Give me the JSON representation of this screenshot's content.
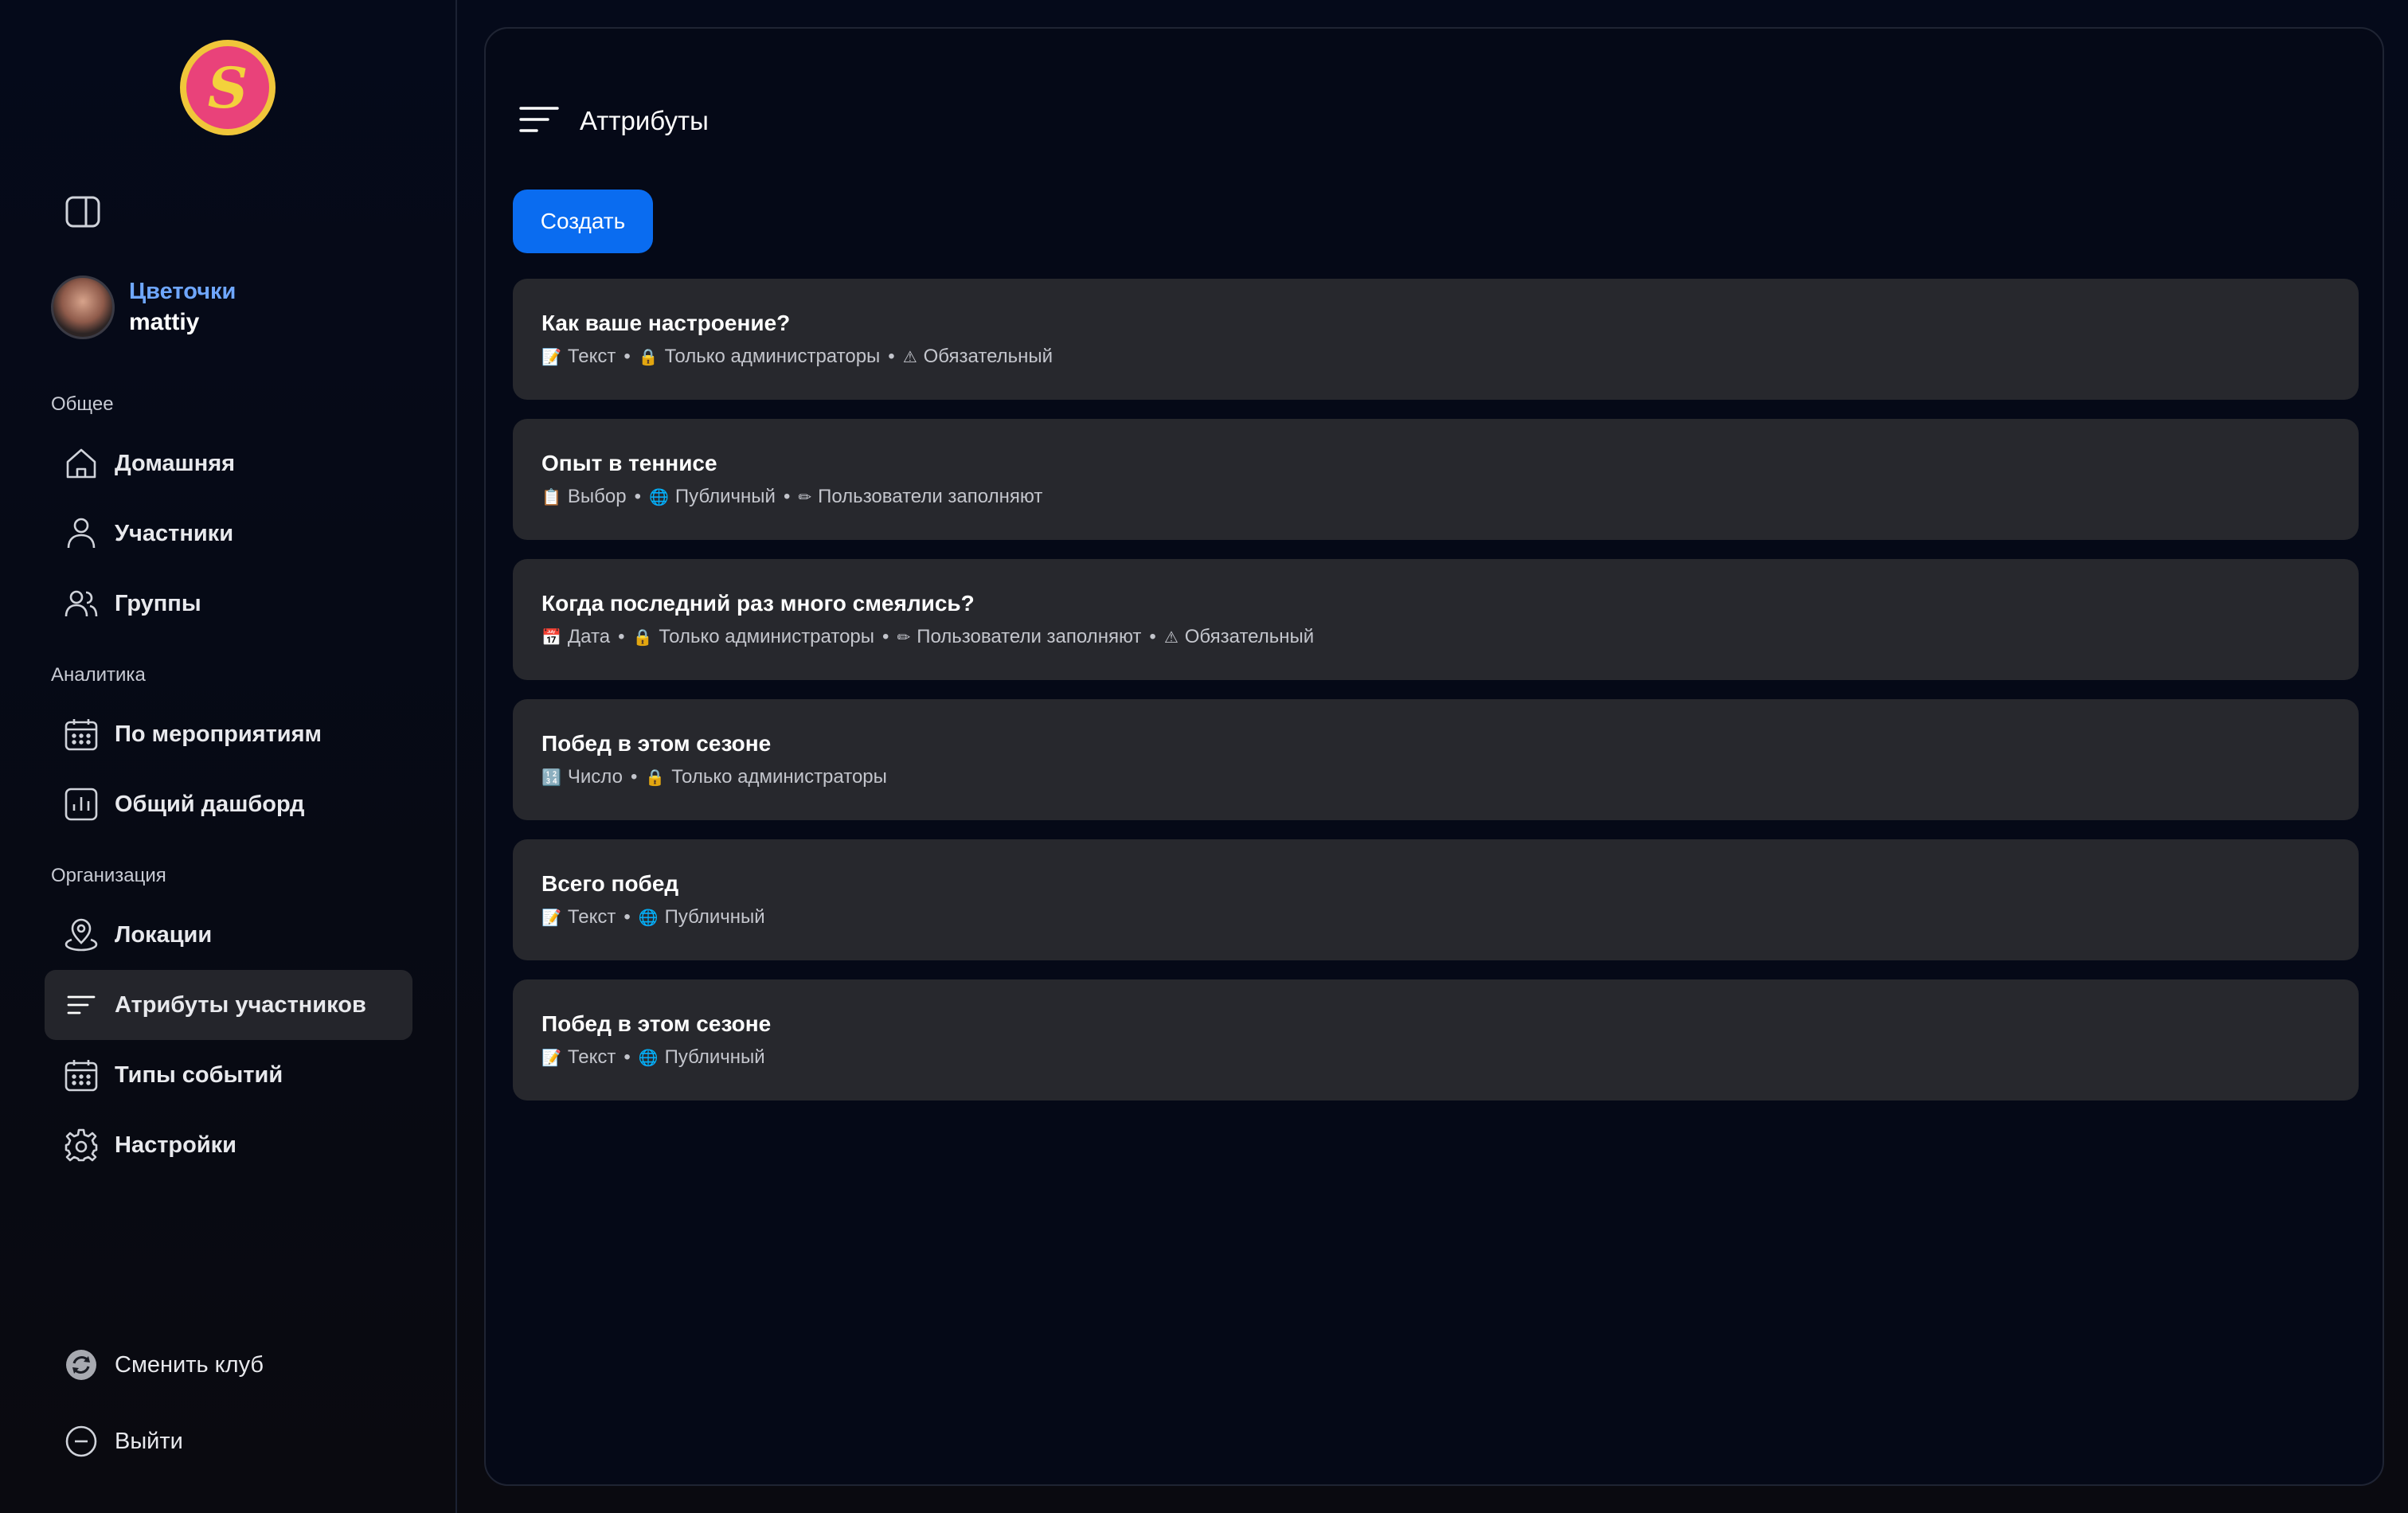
{
  "sidebar": {
    "logo_mark": "S",
    "profile": {
      "club_name": "Цветочки",
      "user_name": "mattiy"
    },
    "sections": [
      {
        "label": "Общее"
      },
      {
        "label": "Аналитика"
      },
      {
        "label": "Организация"
      }
    ],
    "items": [
      {
        "label": "Домашняя",
        "icon": "home-icon"
      },
      {
        "label": "Участники",
        "icon": "user-icon"
      },
      {
        "label": "Группы",
        "icon": "users-icon"
      },
      {
        "label": "По мероприятиям",
        "icon": "calendar-icon"
      },
      {
        "label": "Общий дашборд",
        "icon": "chart-icon"
      },
      {
        "label": "Локации",
        "icon": "location-icon"
      },
      {
        "label": "Атрибуты участников",
        "icon": "list-icon",
        "active": true
      },
      {
        "label": "Типы событий",
        "icon": "calendar-icon"
      },
      {
        "label": "Настройки",
        "icon": "gear-icon"
      }
    ],
    "footer": {
      "switch_club": "Сменить клуб",
      "logout": "Выйти"
    }
  },
  "main": {
    "title": "Аттрибуты",
    "create_label": "Создать",
    "attributes": [
      {
        "title": "Как ваше настроение?",
        "meta": [
          {
            "emoji": "📝",
            "text": "Текст"
          },
          {
            "emoji": "🔒",
            "text": "Только администраторы"
          },
          {
            "emoji": "⚠",
            "text": "Обязательный"
          }
        ]
      },
      {
        "title": "Опыт в теннисе",
        "meta": [
          {
            "emoji": "📋",
            "text": "Выбор"
          },
          {
            "emoji": "🌐",
            "text": "Публичный"
          },
          {
            "emoji": "✏",
            "text": "Пользователи заполняют"
          }
        ]
      },
      {
        "title": "Когда последний раз много смеялись?",
        "meta": [
          {
            "emoji": "📅",
            "text": "Дата"
          },
          {
            "emoji": "🔒",
            "text": "Только администраторы"
          },
          {
            "emoji": "✏",
            "text": "Пользователи заполняют"
          },
          {
            "emoji": "⚠",
            "text": "Обязательный"
          }
        ]
      },
      {
        "title": "Побед в этом сезоне",
        "meta": [
          {
            "emoji": "🔢",
            "text": "Число"
          },
          {
            "emoji": "🔒",
            "text": "Только администраторы"
          }
        ]
      },
      {
        "title": "Всего побед",
        "meta": [
          {
            "emoji": "📝",
            "text": "Текст"
          },
          {
            "emoji": "🌐",
            "text": "Публичный"
          }
        ]
      },
      {
        "title": "Побед в этом сезоне",
        "meta": [
          {
            "emoji": "📝",
            "text": "Текст"
          },
          {
            "emoji": "🌐",
            "text": "Публичный"
          }
        ]
      }
    ]
  },
  "colors": {
    "accent": "#0a6cf0",
    "club_name": "#6fa7ff",
    "card_bg": "#27282d",
    "active_nav_bg": "#24252b"
  }
}
